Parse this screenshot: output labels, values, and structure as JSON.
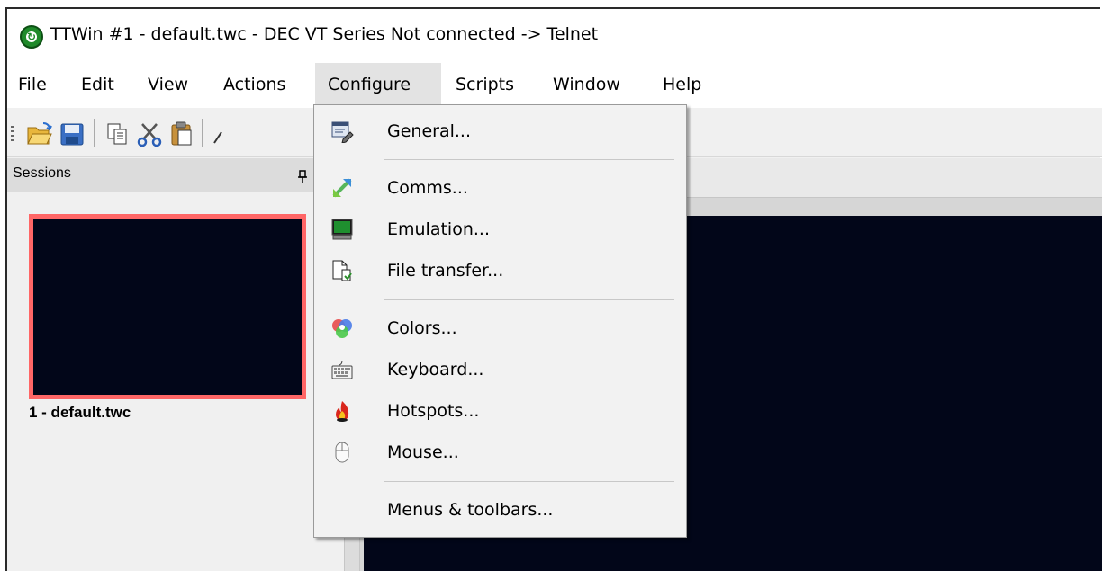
{
  "window": {
    "title": "TTWin #1 - default.twc - DEC VT Series Not connected -> Telnet",
    "icon": "ttwin-app-icon"
  },
  "menubar": {
    "items": [
      {
        "label": "File"
      },
      {
        "label": "Edit"
      },
      {
        "label": "View"
      },
      {
        "label": "Actions"
      },
      {
        "label": "Configure",
        "active": true
      },
      {
        "label": "Scripts"
      },
      {
        "label": "Window"
      },
      {
        "label": "Help"
      }
    ]
  },
  "toolbar": {
    "buttons": [
      "open-folder-icon",
      "save-icon",
      "copy-icon",
      "cut-icon",
      "paste-icon"
    ]
  },
  "sessions": {
    "title": "Sessions",
    "pin_icon": "pin-icon",
    "items": [
      {
        "label": "1 - default.twc",
        "selected_color": "#ff6666"
      }
    ]
  },
  "configure_menu": {
    "items": [
      {
        "label": "General...",
        "icon": "general-settings-icon"
      },
      {
        "label": "Comms...",
        "icon": "comms-arrows-icon"
      },
      {
        "label": "Emulation...",
        "icon": "emulation-monitor-icon"
      },
      {
        "label": "File transfer...",
        "icon": "file-transfer-icon"
      },
      {
        "label": "Colors...",
        "icon": "colors-icon"
      },
      {
        "label": "Keyboard...",
        "icon": "keyboard-icon"
      },
      {
        "label": "Hotspots...",
        "icon": "hotspots-flame-icon"
      },
      {
        "label": "Mouse...",
        "icon": "mouse-icon"
      },
      {
        "label": "Menus & toolbars...",
        "icon": ""
      }
    ]
  },
  "colors": {
    "terminal_background": "#020619",
    "session_highlight": "#ff6666",
    "menu_background": "#f2f2f2"
  }
}
